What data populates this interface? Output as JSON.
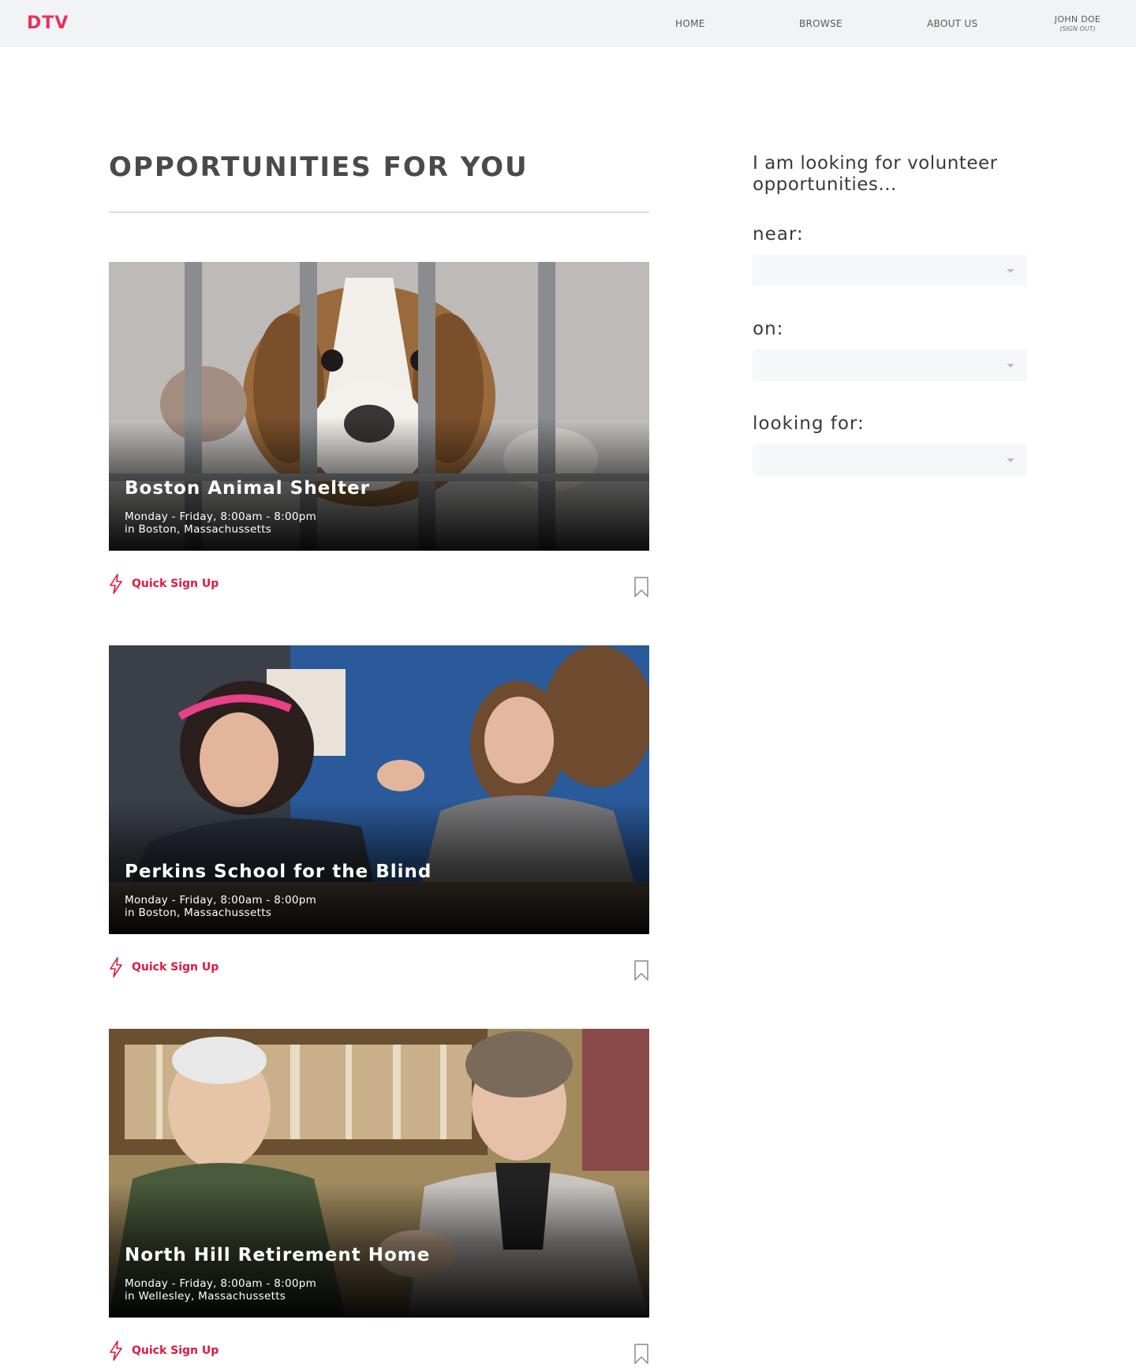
{
  "header": {
    "logo": "DTV",
    "nav": {
      "home": "HOME",
      "browse": "BROWSE",
      "about": "ABOUT US"
    },
    "user": {
      "name": "JOHN DOE",
      "signout": "(SIGN OUT)"
    }
  },
  "main": {
    "title": "OPPORTUNITIES FOR YOU",
    "opportunities": [
      {
        "name": "Boston Animal Shelter",
        "schedule": "Monday - Friday, 8:00am - 8:00pm",
        "location": "in Boston, Massachussetts",
        "quick_signup": "Quick Sign Up"
      },
      {
        "name": "Perkins School for the Blind",
        "schedule": "Monday - Friday, 8:00am - 8:00pm",
        "location": "in Boston, Massachussetts",
        "quick_signup": "Quick Sign Up"
      },
      {
        "name": "North Hill Retirement Home",
        "schedule": "Monday - Friday, 8:00am - 8:00pm",
        "location": "in Wellesley, Massachussetts",
        "quick_signup": "Quick Sign Up"
      }
    ]
  },
  "filters": {
    "intro": "I am looking for volunteer opportunities...",
    "near": {
      "label": "near:",
      "value": ""
    },
    "on": {
      "label": "on:",
      "value": ""
    },
    "looking_for": {
      "label": "looking for:",
      "value": ""
    }
  },
  "colors": {
    "brand": "#e5345a",
    "accent": "#e0193f",
    "navbar_bg": "#f1f3f5",
    "select_bg": "#f6f7f8"
  },
  "icons": {
    "quick_signup": "lightning-bolt-icon",
    "save": "bookmark-icon",
    "dropdown": "chevron-down-icon"
  }
}
